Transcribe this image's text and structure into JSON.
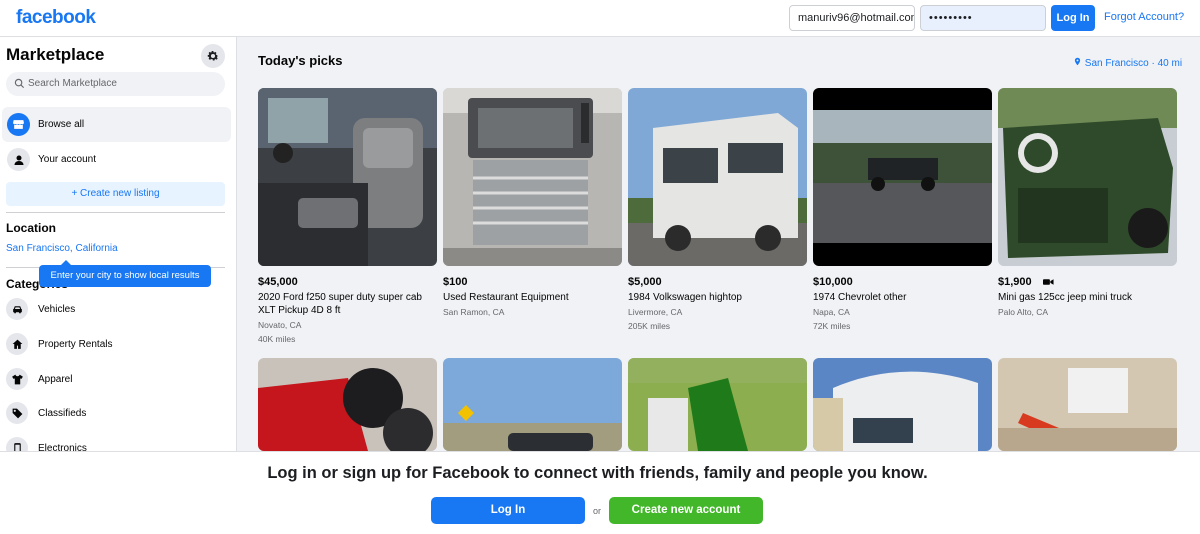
{
  "header": {
    "logo": "facebook",
    "email_value": "manuriv96@hotmail.com",
    "password_value": "•••••••••",
    "login_label": "Log In",
    "forgot_label": "Forgot Account?"
  },
  "sidebar": {
    "title": "Marketplace",
    "search_placeholder": "Search Marketplace",
    "nav": [
      {
        "label": "Browse all",
        "icon": "storefront-icon"
      },
      {
        "label": "Your account",
        "icon": "person-icon"
      }
    ],
    "create_listing": "+ Create new listing",
    "location_heading": "Location",
    "location_value": "San Francisco, California",
    "tooltip": "Enter your city to show local results",
    "categories_heading": "Categories",
    "categories": [
      {
        "label": "Vehicles",
        "icon": "car-icon"
      },
      {
        "label": "Property Rentals",
        "icon": "house-icon"
      },
      {
        "label": "Apparel",
        "icon": "shirt-icon"
      },
      {
        "label": "Classifieds",
        "icon": "tag-icon"
      },
      {
        "label": "Electronics",
        "icon": "phone-icon"
      }
    ]
  },
  "main": {
    "title": "Today's picks",
    "location": "San Francisco · 40 mi",
    "listings": [
      {
        "price": "$45,000",
        "title": "2020 Ford f250 super duty super cab XLT Pickup 4D 8 ft",
        "location": "Novato, CA",
        "mileage": "40K miles"
      },
      {
        "price": "$100",
        "title": "Used Restaurant Equipment",
        "location": "San Ramon, CA",
        "mileage": ""
      },
      {
        "price": "$5,000",
        "title": "1984 Volkswagen hightop",
        "location": "Livermore, CA",
        "mileage": "205K miles"
      },
      {
        "price": "$10,000",
        "title": "1974 Chevrolet other",
        "location": "Napa, CA",
        "mileage": "72K miles"
      },
      {
        "price": "$1,900",
        "title": "Mini gas 125cc jeep mini truck",
        "location": "Palo Alto, CA",
        "mileage": ""
      }
    ]
  },
  "banner": {
    "text": "Log in or sign up for Facebook to connect with friends, family and people you know.",
    "login_label": "Log In",
    "or_label": "or",
    "create_label": "Create new account"
  }
}
